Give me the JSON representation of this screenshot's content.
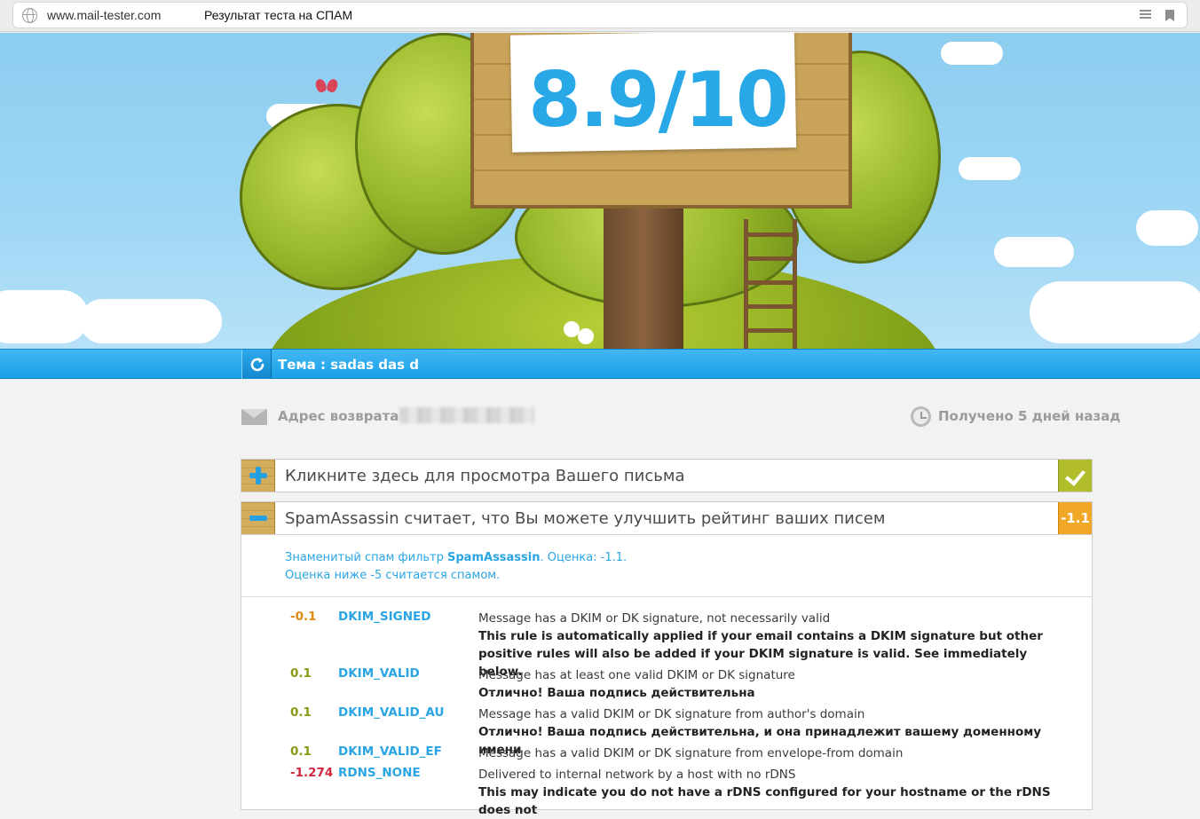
{
  "browser": {
    "url": "www.mail-tester.com",
    "page_title": "Результат теста на СПАМ"
  },
  "hero": {
    "score": "8.9/10"
  },
  "subject_bar": {
    "subject": "Тема : sadas das d"
  },
  "meta": {
    "return_label": "Адрес возврата :",
    "received": "Получено 5 дней назад"
  },
  "panels": {
    "view_email": {
      "title": "Кликните здесь для просмотра Вашего письма"
    },
    "spamassassin": {
      "title": "SpamAssassin считает, что Вы можете улучшить рейтинг ваших писем",
      "badge": "-1.1",
      "intro_prefix": "Знаменитый спам фильтр ",
      "intro_name": "SpamAssassin",
      "intro_suffix": ". Оценка: -1.1.",
      "intro_line2": "Оценка ниже -5 считается спамом."
    }
  },
  "rules": [
    {
      "score": "-0.1",
      "score_color": "#e08a14",
      "name": "DKIM_SIGNED",
      "desc": "Message has a DKIM or DK signature, not necessarily valid",
      "note": "This rule is automatically applied if your email contains a DKIM signature but other positive rules will also be added if your DKIM signature is valid. See immediately below."
    },
    {
      "score": "0.1",
      "score_color": "#8a9a14",
      "name": "DKIM_VALID",
      "desc": "Message has at least one valid DKIM or DK signature",
      "note": "Отлично! Ваша подпись действительна"
    },
    {
      "score": "0.1",
      "score_color": "#8a9a14",
      "name": "DKIM_VALID_AU",
      "desc": "Message has a valid DKIM or DK signature from author's domain",
      "note": "Отлично! Ваша подпись действительна, и она принадлежит вашему доменному имени"
    },
    {
      "score": "0.1",
      "score_color": "#8a9a14",
      "name": "DKIM_VALID_EF",
      "desc": "Message has a valid DKIM or DK signature from envelope-from domain",
      "note": ""
    },
    {
      "score": "-1.274",
      "score_color": "#d0273e",
      "name": "RDNS_NONE",
      "desc": "Delivered to internal network by a host with no rDNS",
      "note": "This may indicate you do not have a rDNS configured for your hostname or the rDNS does not"
    }
  ]
}
